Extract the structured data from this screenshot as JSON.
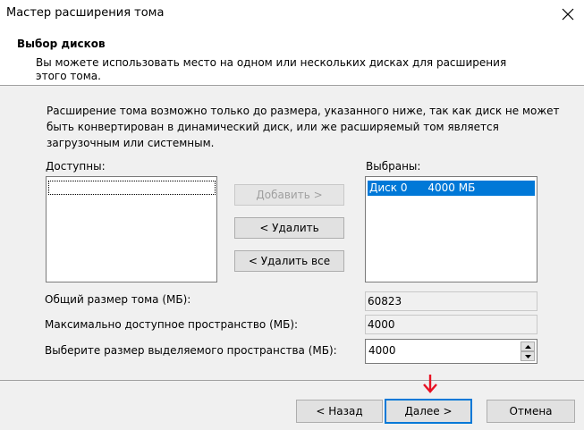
{
  "window": {
    "title": "Мастер расширения тома"
  },
  "header": {
    "title": "Выбор дисков",
    "subtitle": "Вы можете использовать место на одном или нескольких дисках для расширения этого тома."
  },
  "description": "Расширение тома возможно только до размера, указанного ниже, так как диск не может быть конвертирован в динамический диск, или же расширяемый том является загрузочным или системным.",
  "available": {
    "label": "Доступны:",
    "items": []
  },
  "selected": {
    "label": "Выбраны:",
    "items": [
      {
        "disk": "Диск 0",
        "size": "4000 МБ"
      }
    ]
  },
  "buttons": {
    "add": "Добавить >",
    "remove": "< Удалить",
    "remove_all": "< Удалить все",
    "back": "< Назад",
    "next": "Далее >",
    "cancel": "Отмена"
  },
  "fields": {
    "total_size_label": "Общий размер тома (МБ):",
    "total_size_value": "60823",
    "max_space_label": "Максимально доступное пространство (МБ):",
    "max_space_value": "4000",
    "choose_size_label": "Выберите размер выделяемого пространства (МБ):",
    "choose_size_value": "4000"
  },
  "colors": {
    "selection": "#0078d7",
    "arrow": "#e81123"
  },
  "icons": {
    "close": "close-icon",
    "spin_up": "spin-up-icon",
    "spin_down": "spin-down-icon",
    "annotation": "red-down-arrow-icon"
  }
}
